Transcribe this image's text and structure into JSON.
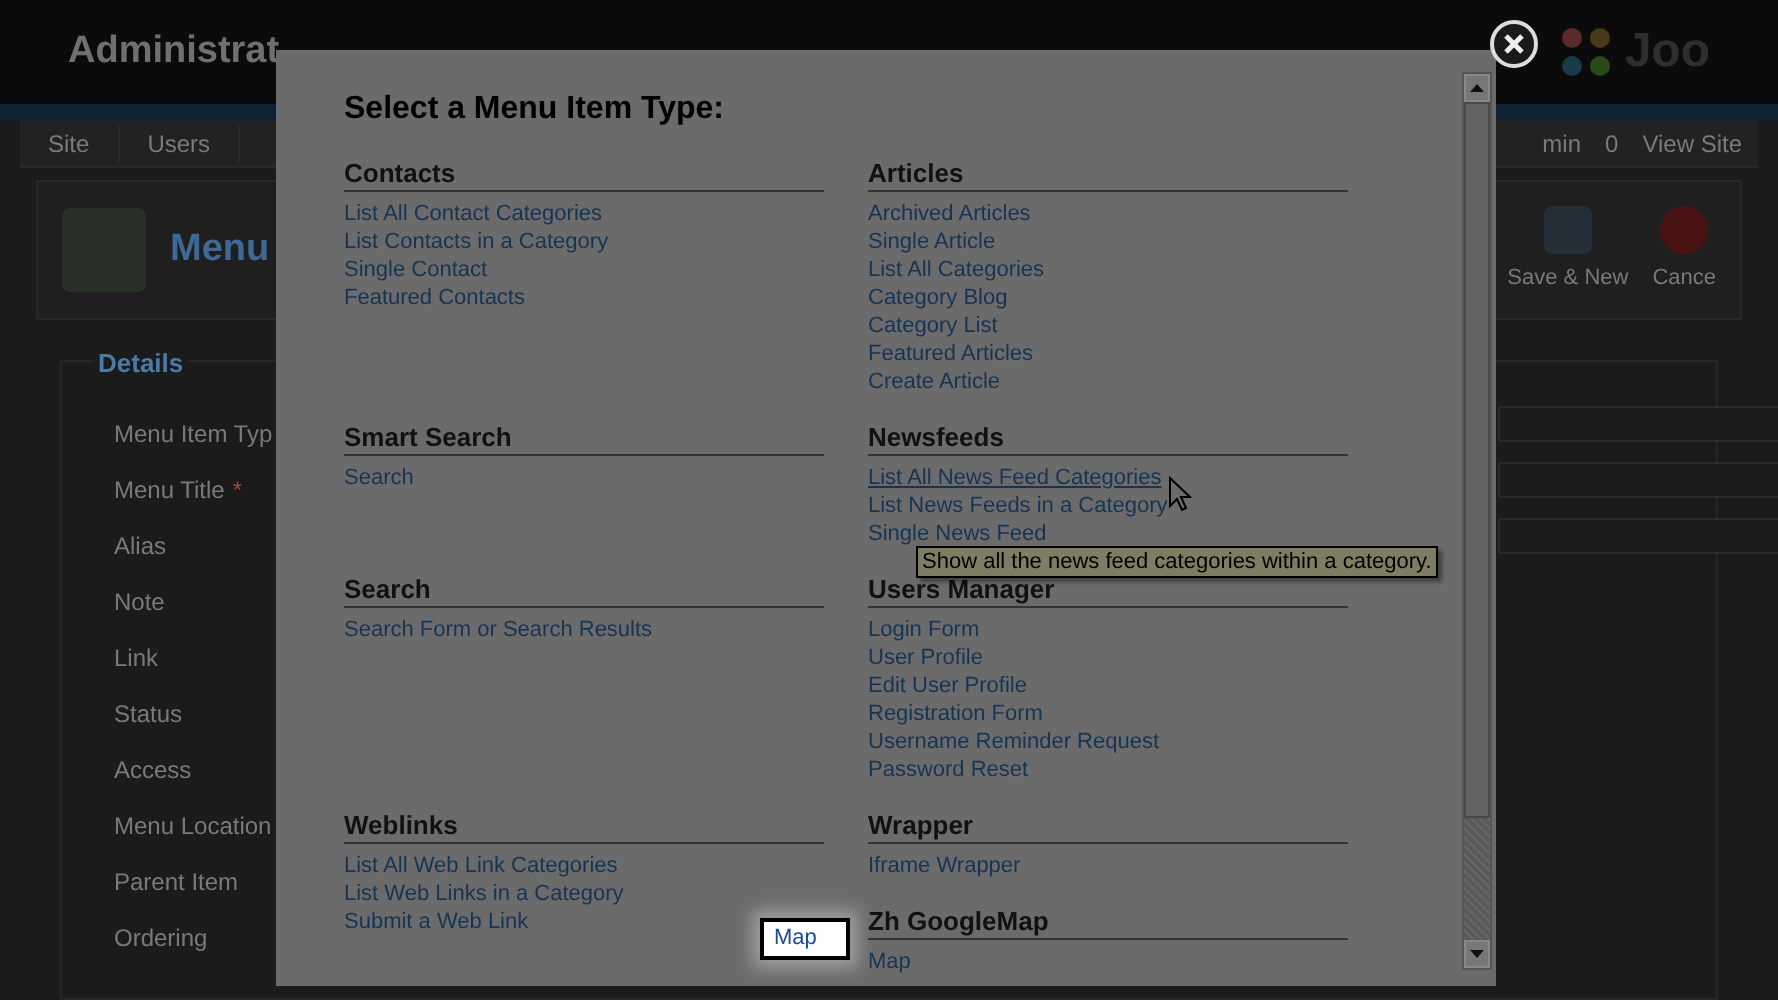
{
  "background": {
    "header_title": "Administrat",
    "logo_text": "Joo",
    "menu_tabs": [
      "Site",
      "Users"
    ],
    "status_items": [
      "min",
      "0",
      "View Site"
    ],
    "page_title": "Menu",
    "toolbar_buttons": [
      {
        "label": "Save & New",
        "kind": "save"
      },
      {
        "label": "Cance",
        "kind": "cancel"
      }
    ],
    "form": {
      "legend": "Details",
      "labels": [
        "Menu Item Typ",
        "Menu Title",
        "Alias",
        "Note",
        "Link",
        "Status",
        "Access",
        "Menu Location",
        "Parent Item",
        "Ordering"
      ],
      "required_mark": "*"
    }
  },
  "modal": {
    "title": "Select a Menu Item Type:",
    "rows": [
      [
        {
          "heading": "Contacts",
          "links": [
            {
              "text": "List All Contact Categories",
              "hovered": false
            },
            {
              "text": "List Contacts in a Category",
              "hovered": false
            },
            {
              "text": "Single Contact",
              "hovered": false
            },
            {
              "text": "Featured Contacts",
              "hovered": false
            }
          ]
        },
        {
          "heading": "Articles",
          "links": [
            {
              "text": "Archived Articles",
              "hovered": false
            },
            {
              "text": "Single Article",
              "hovered": false
            },
            {
              "text": "List All Categories",
              "hovered": false
            },
            {
              "text": "Category Blog",
              "hovered": false
            },
            {
              "text": "Category List",
              "hovered": false
            },
            {
              "text": "Featured Articles",
              "hovered": false
            },
            {
              "text": "Create Article",
              "hovered": false
            }
          ]
        }
      ],
      [
        {
          "heading": "Smart Search",
          "links": [
            {
              "text": "Search",
              "hovered": false
            }
          ]
        },
        {
          "heading": "Newsfeeds",
          "links": [
            {
              "text": "List All News Feed Categories",
              "hovered": true
            },
            {
              "text": "List News Feeds in a Category",
              "hovered": false
            },
            {
              "text": "Single News Feed",
              "hovered": false
            }
          ]
        }
      ],
      [
        {
          "heading": "Search",
          "links": [
            {
              "text": "Search Form or Search Results",
              "hovered": false
            }
          ]
        },
        {
          "heading": "Users Manager",
          "links": [
            {
              "text": "Login Form",
              "hovered": false
            },
            {
              "text": "User Profile",
              "hovered": false
            },
            {
              "text": "Edit User Profile",
              "hovered": false
            },
            {
              "text": "Registration Form",
              "hovered": false
            },
            {
              "text": "Username Reminder Request",
              "hovered": false
            },
            {
              "text": "Password Reset",
              "hovered": false
            }
          ]
        }
      ],
      [
        {
          "heading": "Weblinks",
          "links": [
            {
              "text": "List All Web Link Categories",
              "hovered": false
            },
            {
              "text": "List Web Links in a Category",
              "hovered": false
            },
            {
              "text": "Submit a Web Link",
              "hovered": false
            }
          ]
        },
        {
          "heading": "Wrapper",
          "links": [
            {
              "text": "Iframe Wrapper",
              "hovered": false
            }
          ]
        }
      ],
      [
        null,
        {
          "heading": "Zh GoogleMap",
          "links": [
            {
              "text": "Map",
              "hovered": false
            }
          ]
        }
      ]
    ],
    "tooltip": "Show all the news feed categories within a category.",
    "callout": "Map"
  }
}
